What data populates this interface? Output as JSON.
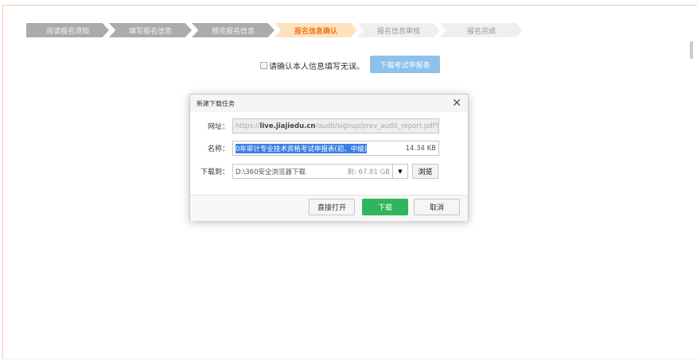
{
  "steps": [
    {
      "label": "阅读报名须知",
      "state": "done"
    },
    {
      "label": "填写报名信息",
      "state": "done"
    },
    {
      "label": "预览报名信息",
      "state": "done"
    },
    {
      "label": "报名信息确认",
      "state": "active"
    },
    {
      "label": "报名信息审核",
      "state": "todo"
    },
    {
      "label": "报名完成",
      "state": "todo"
    }
  ],
  "confirm_text": "请确认本人信息填写无误。",
  "download_form_button": "下载考试申报表",
  "dialog": {
    "title": "新建下载任务",
    "url_label": "网址：",
    "url_prefix": "https://",
    "url_domain": "live.jiajiedu.cn",
    "url_path": "/audit/signup/prev_audit_report.pdf%",
    "name_label": "名称：",
    "name_value": "0年审计专业技术资格考试申报表(初、中级)",
    "file_size": "14.34 KB",
    "dir_label": "下载到：",
    "dir_value": "D:\\360安全浏览器下载",
    "free_space": "剩: 67.81 GB",
    "browse": "浏览",
    "open_directly": "直接打开",
    "download": "下载",
    "cancel": "取消"
  }
}
